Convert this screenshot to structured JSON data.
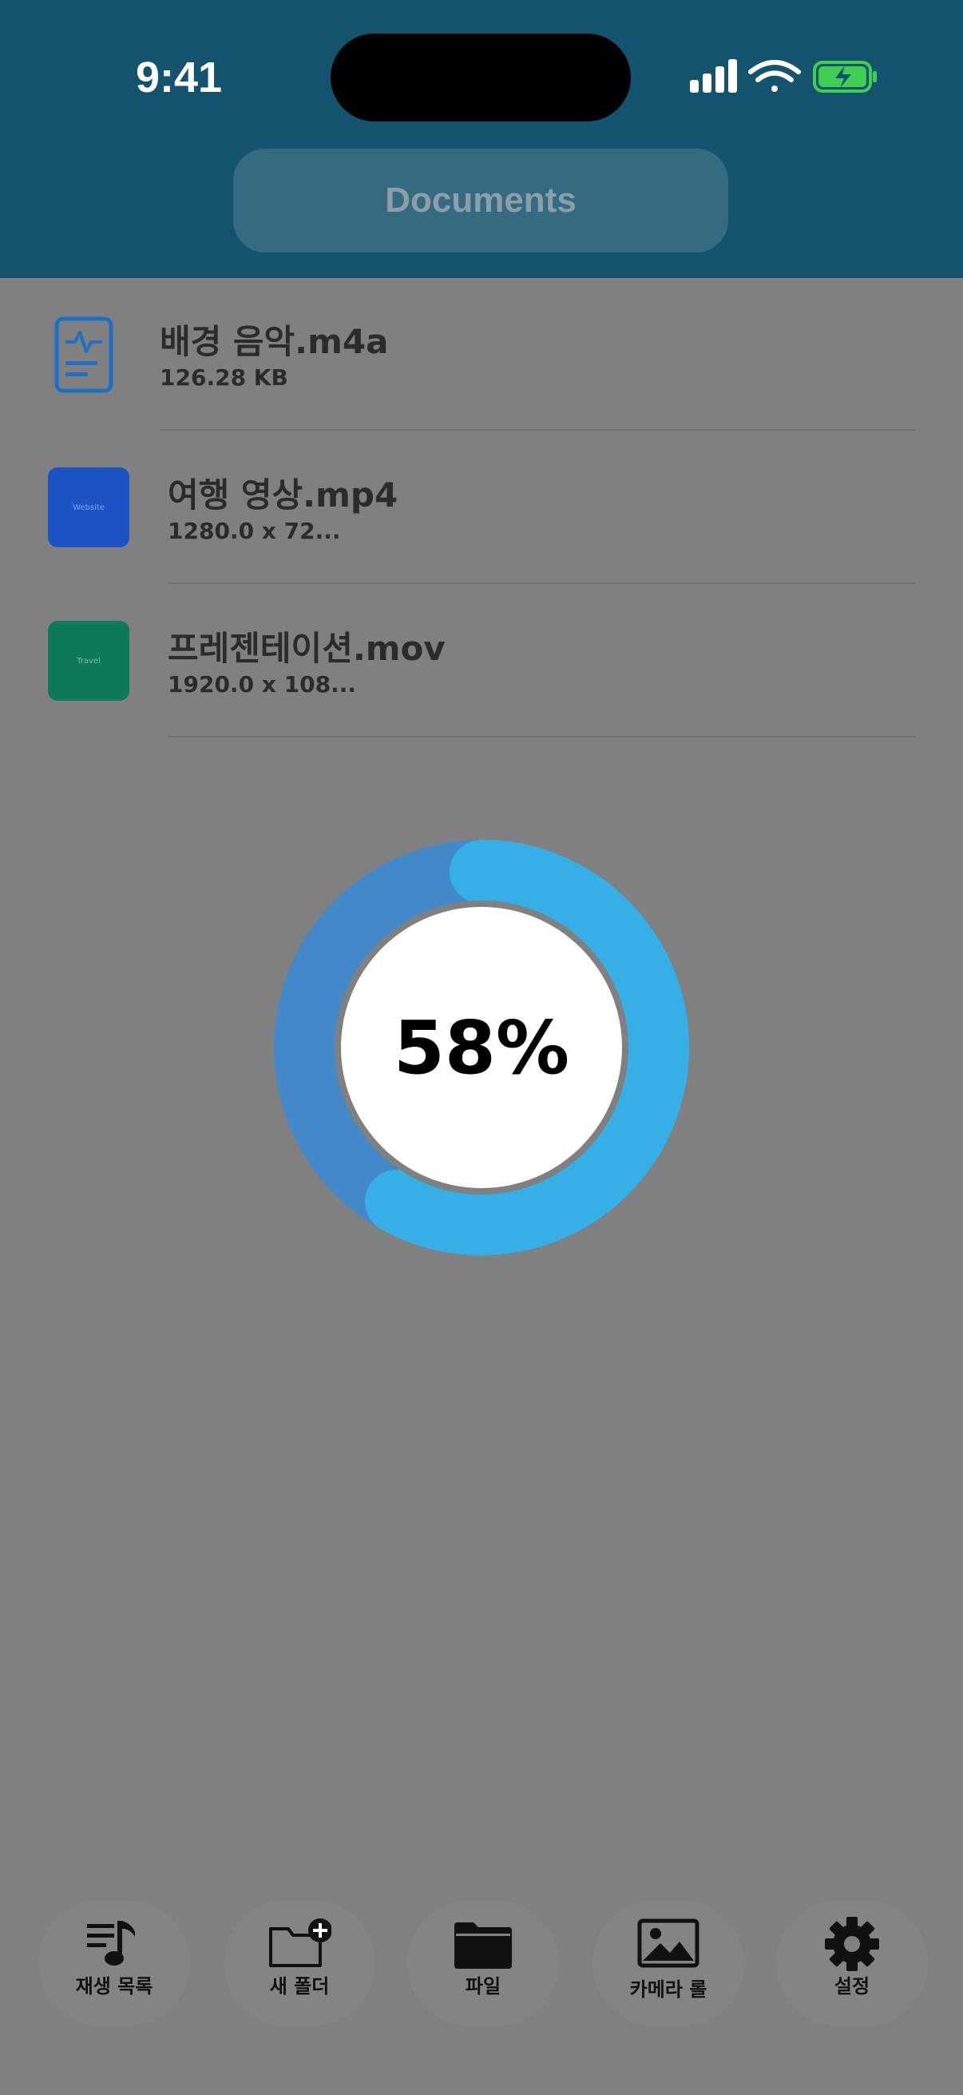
{
  "status_bar": {
    "time": "9:41"
  },
  "header": {
    "title": "Documents"
  },
  "files": [
    {
      "name": "배경 음악.m4a",
      "meta": "126.28 KB",
      "icon": "audio-file-icon"
    },
    {
      "name": "여행 영상.mp4",
      "meta": "1280.0 x 72...",
      "thumb_text": "Website",
      "thumb_color": "#1b52c4"
    },
    {
      "name": "프레젠테이션.mov",
      "meta": "1920.0 x 108...",
      "thumb_text": "Travel",
      "thumb_color": "#0f7a5a"
    }
  ],
  "progress": {
    "label": "58%",
    "value": 0.58,
    "track_color": "#4388c8",
    "fill_color": "#36aee6"
  },
  "tabs": [
    {
      "label": "재생 목록",
      "icon": "playlist-icon"
    },
    {
      "label": "새 폴더",
      "icon": "new-folder-icon"
    },
    {
      "label": "파일",
      "icon": "folder-icon"
    },
    {
      "label": "카메라 롤",
      "icon": "photo-icon"
    },
    {
      "label": "설정",
      "icon": "gear-icon"
    }
  ]
}
